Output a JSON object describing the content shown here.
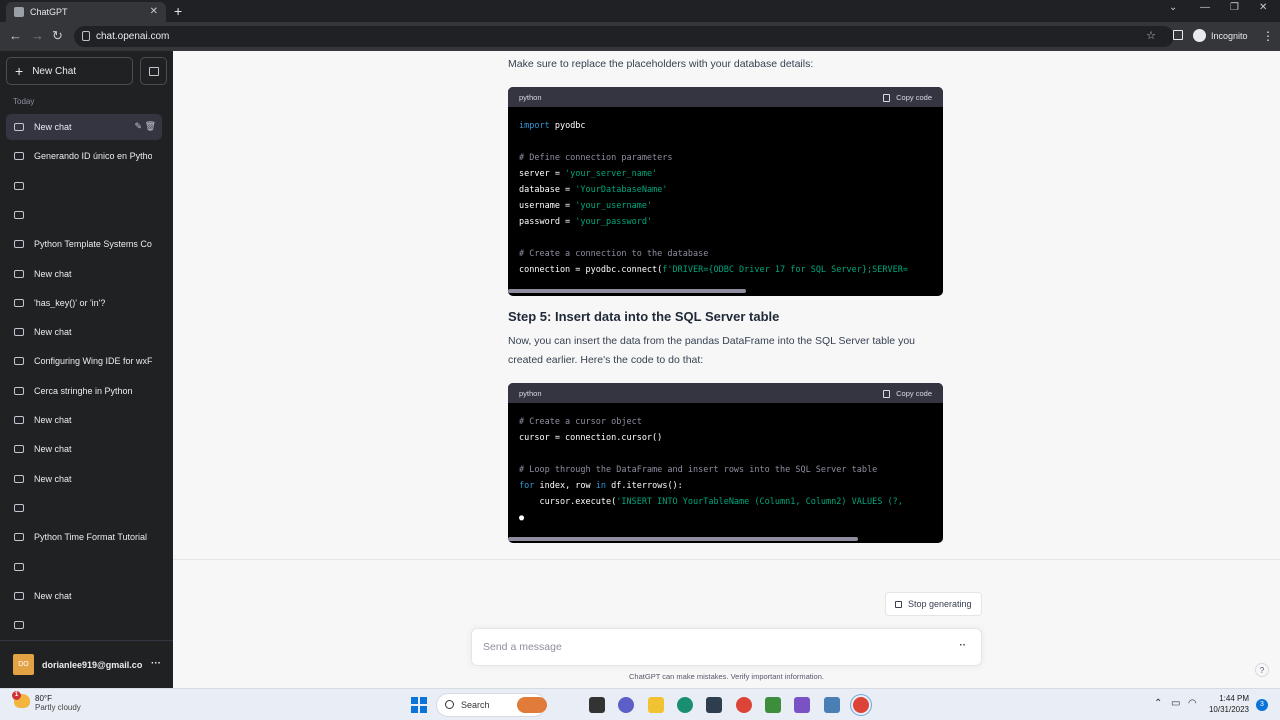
{
  "browser": {
    "tab_title": "ChatGPT",
    "url": "chat.openai.com",
    "incognito_label": "Incognito"
  },
  "sidebar": {
    "new_chat_label": "New Chat",
    "section_label": "Today",
    "items": [
      {
        "label": "New chat"
      },
      {
        "label": "Generando ID único en Pytho"
      },
      {
        "label": ""
      },
      {
        "label": ""
      },
      {
        "label": "Python Template Systems Co"
      },
      {
        "label": "New chat"
      },
      {
        "label": "'has_key()' or 'in'?"
      },
      {
        "label": "New chat"
      },
      {
        "label": "Configuring Wing IDE for wxF"
      },
      {
        "label": "Cerca stringhe in Python"
      },
      {
        "label": "New chat"
      },
      {
        "label": "New chat"
      },
      {
        "label": "New chat"
      },
      {
        "label": ""
      },
      {
        "label": "Python Time Format Tutorial"
      },
      {
        "label": ""
      },
      {
        "label": "New chat"
      },
      {
        "label": ""
      }
    ],
    "user": {
      "initials": "DO",
      "email": "dorianlee919@gmail.co"
    }
  },
  "chat": {
    "intro_text": "Make sure to replace the placeholders with your database details:",
    "code1": {
      "lang": "python",
      "copy_label": "Copy code",
      "lines": [
        [
          {
            "c": "kw",
            "t": "import"
          },
          {
            "c": "",
            "t": " pyodbc"
          }
        ],
        [
          {
            "c": "",
            "t": ""
          }
        ],
        [
          {
            "c": "cm",
            "t": "# Define connection parameters"
          }
        ],
        [
          {
            "c": "",
            "t": "server = "
          },
          {
            "c": "st",
            "t": "'your_server_name'"
          }
        ],
        [
          {
            "c": "",
            "t": "database = "
          },
          {
            "c": "st",
            "t": "'YourDatabaseName'"
          }
        ],
        [
          {
            "c": "",
            "t": "username = "
          },
          {
            "c": "st",
            "t": "'your_username'"
          }
        ],
        [
          {
            "c": "",
            "t": "password = "
          },
          {
            "c": "st",
            "t": "'your_password'"
          }
        ],
        [
          {
            "c": "",
            "t": ""
          }
        ],
        [
          {
            "c": "cm",
            "t": "# Create a connection to the database"
          }
        ],
        [
          {
            "c": "",
            "t": "connection = pyodbc.connect("
          },
          {
            "c": "st",
            "t": "f'DRIVER={ODBC Driver 17 for SQL Server};SERVER="
          }
        ]
      ]
    },
    "step_heading": "Step 5: Insert data into the SQL Server table",
    "step_text": "Now, you can insert the data from the pandas DataFrame into the SQL Server table you created earlier. Here's the code to do that:",
    "code2": {
      "lang": "python",
      "copy_label": "Copy code",
      "lines": [
        [
          {
            "c": "cm",
            "t": "# Create a cursor object"
          }
        ],
        [
          {
            "c": "",
            "t": "cursor = connection.cursor()"
          }
        ],
        [
          {
            "c": "",
            "t": ""
          }
        ],
        [
          {
            "c": "cm",
            "t": "# Loop through the DataFrame and insert rows into the SQL Server table"
          }
        ],
        [
          {
            "c": "kw",
            "t": "for"
          },
          {
            "c": "",
            "t": " index, row "
          },
          {
            "c": "kw",
            "t": "in"
          },
          {
            "c": "",
            "t": " df.iterrows():"
          }
        ],
        [
          {
            "c": "",
            "t": "    cursor.execute("
          },
          {
            "c": "st",
            "t": "'INSERT INTO YourTableName (Column1, Column2) VALUES (?,"
          }
        ],
        [
          {
            "c": "",
            "t": "●"
          }
        ]
      ]
    },
    "stop_label": "Stop generating",
    "input_placeholder": "Send a message",
    "disclaimer": "ChatGPT can make mistakes. Verify important information.",
    "help": "?"
  },
  "taskbar": {
    "temp": "80°F",
    "weather": "Partly cloudy",
    "weather_badge": "1",
    "search_label": "Search",
    "time": "1:44 PM",
    "date": "10/31/2023",
    "notif_count": "3"
  }
}
